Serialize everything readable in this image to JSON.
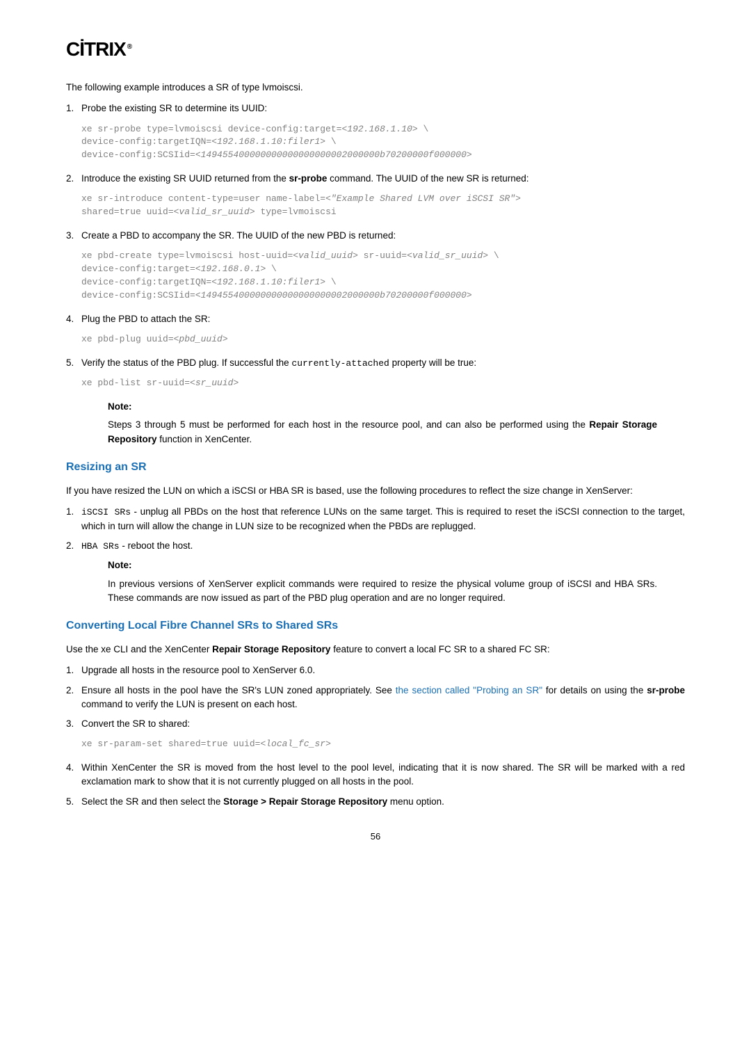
{
  "logo": "CİTRIX",
  "intro": "The following example introduces a SR of type lvmoiscsi.",
  "step1": {
    "num": "1.",
    "text": "Probe the existing SR to determine its UUID:"
  },
  "code1": {
    "l1a": "xe sr-probe type=lvmoiscsi device-config:target=",
    "l1b": "<192.168.1.10>",
    "l1c": " \\",
    "l2a": "device-config:targetIQN=",
    "l2b": "<192.168.1.10:filer1>",
    "l2c": " \\",
    "l3a": "device-config:SCSIid=",
    "l3b": "<149455400000000000000000002000000b70200000f000000>"
  },
  "step2": {
    "num": "2.",
    "t1": "Introduce the existing SR UUID returned from the ",
    "b1": "sr-probe",
    "t2": " command. The UUID of the new SR is returned:"
  },
  "code2": {
    "l1a": "xe sr-introduce content-type=user name-label=",
    "l1b": "<\"Example Shared LVM over iSCSI SR\">",
    "l2a": "shared=true uuid=",
    "l2b": "<valid_sr_uuid>",
    "l2c": " type=lvmoiscsi"
  },
  "step3": {
    "num": "3.",
    "text": "Create a PBD to accompany the SR. The UUID of the new PBD is returned:"
  },
  "code3": {
    "l1a": "xe pbd-create type=lvmoiscsi host-uuid=",
    "l1b": "<valid_uuid>",
    "l1c": " sr-uuid=",
    "l1d": "<valid_sr_uuid>",
    "l1e": " \\",
    "l2a": "device-config:target=",
    "l2b": "<192.168.0.1>",
    "l2c": " \\",
    "l3a": "device-config:targetIQN=",
    "l3b": "<192.168.1.10:filer1>",
    "l3c": " \\",
    "l4a": "device-config:SCSIid=",
    "l4b": "<149455400000000000000000002000000b70200000f000000>"
  },
  "step4": {
    "num": "4.",
    "text": "Plug the PBD to attach the SR:"
  },
  "code4": {
    "l1a": "xe pbd-plug uuid=",
    "l1b": "<pbd_uuid>"
  },
  "step5": {
    "num": "5.",
    "t1": "Verify the status of the PBD plug. If successful the ",
    "c1": "currently-attached",
    "t2": " property will be true:"
  },
  "code5": {
    "l1a": "xe pbd-list sr-uuid=",
    "l1b": "<sr_uuid>"
  },
  "note1": {
    "label": "Note:",
    "t1": "Steps 3 through 5 must be performed for each host in the resource pool, and can also be performed using the ",
    "b1": "Repair Storage Repository",
    "t2": " function in XenCenter."
  },
  "resizing": {
    "title": "Resizing an SR",
    "intro": "If you have resized the LUN on which a iSCSI or HBA SR is based, use the following procedures to reflect the size change in XenServer:",
    "li1": {
      "num": "1.",
      "c1": "iSCSI SRs",
      "t1": " - unplug all PBDs on the host that reference LUNs on the same target. This is required to reset the iSCSI connection to the target, which in turn will allow the change in LUN size to be recognized when the PBDs are replugged."
    },
    "li2": {
      "num": "2.",
      "c1": "HBA SRs",
      "t1": " - reboot the host."
    }
  },
  "note2": {
    "label": "Note:",
    "body": "In previous versions of XenServer explicit commands were required to resize the physical volume group of iSCSI and HBA SRs. These commands are now issued as part of the PBD plug operation and are no longer required."
  },
  "converting": {
    "title": "Converting Local Fibre Channel SRs to Shared SRs",
    "intro": {
      "t1": "Use the xe CLI and the XenCenter ",
      "b1": "Repair Storage Repository",
      "t2": " feature to convert a local FC SR to a shared FC SR:"
    },
    "li1": {
      "num": "1.",
      "text": "Upgrade all hosts in the resource pool to XenServer 6.0."
    },
    "li2": {
      "num": "2.",
      "t1": "Ensure all hosts in the pool have the SR's LUN zoned appropriately. See ",
      "link": "the section called \"Probing an SR\"",
      "t2": " for details on using the ",
      "b1": "sr-probe",
      "t3": " command to verify the LUN is present on each host."
    },
    "li3": {
      "num": "3.",
      "text": "Convert the SR to shared:"
    },
    "code": {
      "l1a": "xe sr-param-set shared=true uuid=",
      "l1b": "<local_fc_sr>"
    },
    "li4": {
      "num": "4.",
      "text": "Within XenCenter the SR is moved from the host level to the pool level, indicating that it is now shared. The SR will be marked with a red exclamation mark to show that it is not currently plugged on all hosts in the pool."
    },
    "li5": {
      "num": "5.",
      "t1": "Select the SR and then select the ",
      "b1": "Storage > Repair Storage Repository",
      "t2": " menu option."
    }
  },
  "pagenum": "56"
}
